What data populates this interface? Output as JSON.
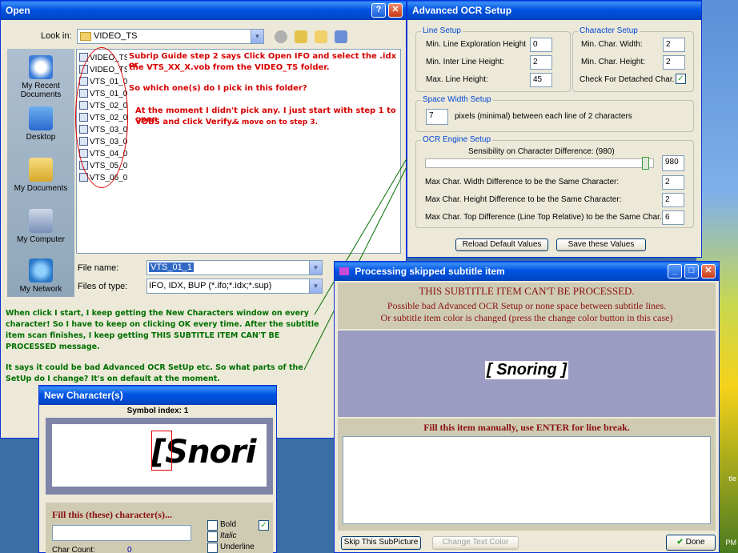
{
  "open_dialog": {
    "title": "Open",
    "look_in_label": "Look in:",
    "look_in_value": "VIDEO_TS",
    "places": [
      "My Recent Documents",
      "Desktop",
      "My Documents",
      "My Computer",
      "My Network"
    ],
    "files": [
      "VIDEO_TS",
      "VIDEO_TS",
      "VTS_01_0",
      "VTS_01_0",
      "VTS_02_0",
      "VTS_02_0",
      "VTS_03_0",
      "VTS_03_0",
      "VTS_04_0",
      "VTS_05_0",
      "VTS_06_0"
    ],
    "file_name_label": "File name:",
    "file_name_value": "VTS_01_1",
    "files_of_type_label": "Files of type:",
    "files_of_type_value": "IFO, IDX, BUP (*.ifo;*.idx;*.sup)",
    "note_1a": "Subrip Guide step 2 says Click Open IFO and select the .idx or",
    "note_1b": "the VTS_XX_X.vob from the VIDEO_TS folder.",
    "note_2": "So which one(s) do I pick in this folder?",
    "note_3a": "At the moment I didn't pick any. I just start with step 1 to open",
    "note_3b": "VOBS and click Verify.",
    "note_3c": "& move on to step 3.",
    "green_1": "When click I start, I keep getting the New Characters window on every",
    "green_2": "character! So I have to keep on clicking OK every time. After the subtitle",
    "green_3": "item scan finishes, I keep getting THIS SUBTITLE ITEM CAN'T BE",
    "green_4": "PROCESSED message.",
    "green_5": "It says it could be bad Advanced OCR SetUp etc. So what parts of the",
    "green_6": "SetUp do I change? It's on default at the moment."
  },
  "ocr_setup": {
    "title": "Advanced OCR Setup",
    "line_setup_title": "Line Setup",
    "min_line_expl_label": "Min. Line Exploration Height",
    "min_line_expl_value": "0",
    "min_inter_line_label": "Min. Inter Line Height:",
    "min_inter_line_value": "2",
    "max_line_label": "Max. Line Height:",
    "max_line_value": "45",
    "char_setup_title": "Character Setup",
    "min_char_width_label": "Min. Char. Width:",
    "min_char_width_value": "2",
    "min_char_height_label": "Min. Char. Height:",
    "min_char_height_value": "2",
    "check_detached_label": "Check For Detached Char.",
    "space_width_title": "Space Width Setup",
    "space_value": "7",
    "space_label": "pixels (minimal) between each line of 2 characters",
    "ocr_engine_title": "OCR Engine Setup",
    "sensibility_label": "Sensibility on Character Difference: (980)",
    "sensibility_value": "980",
    "sensibility_fraction": 0.98,
    "max_width_diff_label": "Max Char. Width Difference to be the Same Character:",
    "max_width_diff_value": "2",
    "max_height_diff_label": "Max Char. Height Difference to be the Same Character:",
    "max_height_diff_value": "2",
    "max_top_diff_label": "Max Char. Top Difference (Line Top Relative) to be the Same Char.:",
    "max_top_diff_value": "6",
    "reload_button": "Reload Default Values",
    "save_button": "Save these Values"
  },
  "new_char": {
    "title": "New Character(s)",
    "symbol_index": "Symbol index: 1",
    "preview_text": "[Snori",
    "fill_label": "Fill this (these) character(s)...",
    "bold": "Bold",
    "italic": "Italic",
    "underline": "Underline",
    "char_count_label": "Char Count:",
    "char_count_value": "0"
  },
  "processing": {
    "title": "Processing skipped subtitle item",
    "heading": "THIS SUBTITLE ITEM CAN'T BE PROCESSED.",
    "line1": "Possible bad Advanced OCR Setup or none space between subtitle lines.",
    "line2": "Or subtitle item color is changed (press the change color button in this case)",
    "subtitle_image_text": "[ Snoring ]",
    "fill_label": "Fill this item manually, use ENTER for line break.",
    "skip_button": "Skip This SubPicture",
    "change_color_button": "Change Text Color",
    "done_button": "Done"
  },
  "desktop": {
    "label_1": "tle",
    "label_2": "PM"
  }
}
